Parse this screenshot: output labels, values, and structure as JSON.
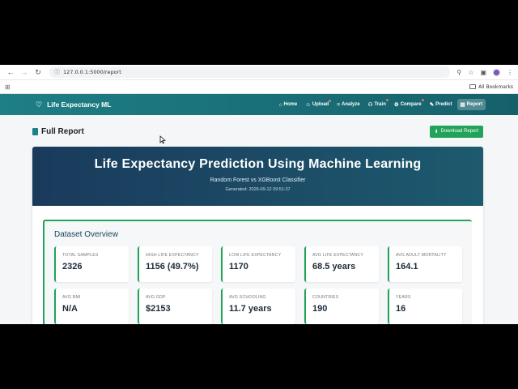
{
  "browser": {
    "url": "127.0.0.1:5000/report",
    "bookmarks_label": "All Bookmarks"
  },
  "app": {
    "brand": "Life Expectancy ML",
    "nav": [
      {
        "label": "Home",
        "icon": "home-icon",
        "active": false,
        "dot": false
      },
      {
        "label": "Upload",
        "icon": "user-icon",
        "active": false,
        "dot": true
      },
      {
        "label": "Analyze",
        "icon": "chart-icon",
        "active": false,
        "dot": false
      },
      {
        "label": "Train",
        "icon": "people-icon",
        "active": false,
        "dot": true
      },
      {
        "label": "Compare",
        "icon": "compare-icon",
        "active": false,
        "dot": true
      },
      {
        "label": "Predict",
        "icon": "pencil-icon",
        "active": false,
        "dot": false
      },
      {
        "label": "Report",
        "icon": "document-icon",
        "active": true,
        "dot": false
      }
    ]
  },
  "page": {
    "title": "Full Report",
    "download_label": "Download Report"
  },
  "report": {
    "title": "Life Expectancy Prediction Using Machine Learning",
    "subtitle": "Random Forest vs XGBoost Classifier",
    "generated": "Generated: 2026-09-12 09:51:37"
  },
  "dataset": {
    "title": "Dataset Overview",
    "stats": [
      {
        "label": "Total Samples",
        "value": "2326"
      },
      {
        "label": "High Life Expectancy",
        "value": "1156 (49.7%)"
      },
      {
        "label": "Low Life Expectancy",
        "value": "1170"
      },
      {
        "label": "Avg Life Expectancy",
        "value": "68.5 years"
      },
      {
        "label": "Avg Adult Mortality",
        "value": "164.1"
      },
      {
        "label": "Avg BMI",
        "value": "N/A"
      },
      {
        "label": "Avg GDP",
        "value": "$2153"
      },
      {
        "label": "Avg Schooling",
        "value": "11.7 years"
      },
      {
        "label": "Countries",
        "value": "190"
      },
      {
        "label": "Years",
        "value": "16"
      }
    ]
  },
  "colors": {
    "nav_bg": "#1e7f86",
    "hero_bg": "#1a3a5c",
    "accent_green": "#22a35a"
  }
}
